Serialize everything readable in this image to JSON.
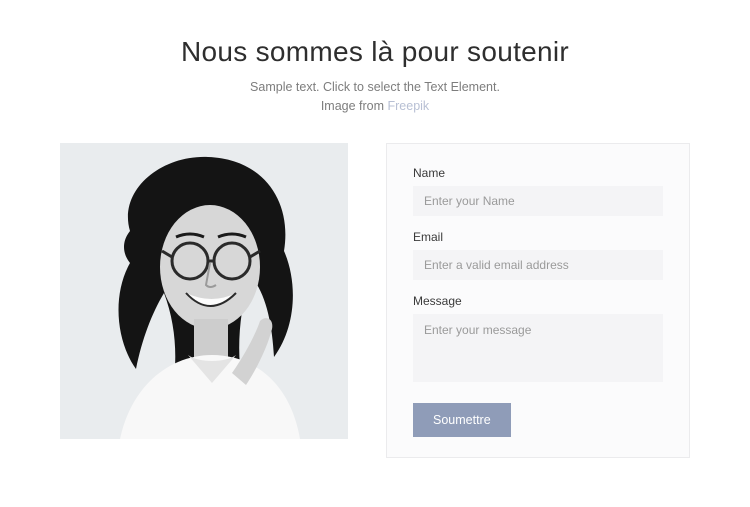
{
  "header": {
    "title": "Nous sommes là pour soutenir",
    "subtitle_line1": "Sample text. Click to select the Text Element.",
    "subtitle_prefix": "Image from ",
    "subtitle_link": "Freepik"
  },
  "form": {
    "name": {
      "label": "Name",
      "placeholder": "Enter your Name",
      "value": ""
    },
    "email": {
      "label": "Email",
      "placeholder": "Enter a valid email address",
      "value": ""
    },
    "message": {
      "label": "Message",
      "placeholder": "Enter your message",
      "value": ""
    },
    "submit_label": "Soumettre"
  },
  "colors": {
    "accent": "#8f9cb8"
  }
}
